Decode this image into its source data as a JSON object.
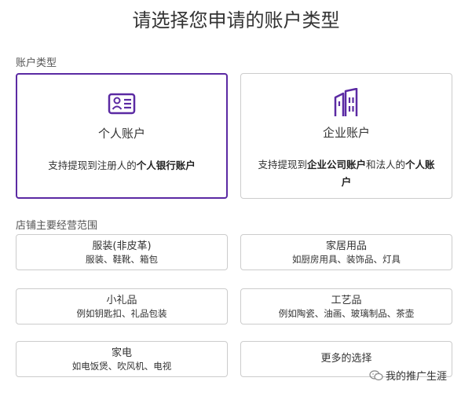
{
  "page": {
    "title": "请选择您申请的账户类型"
  },
  "account_section": {
    "label": "账户类型",
    "personal": {
      "name": "个人账户",
      "desc_prefix": "支持提现到注册人的",
      "desc_bold": "个人银行账户",
      "icon": "id-card-icon",
      "selected": true
    },
    "business": {
      "name": "企业账户",
      "desc_prefix": "支持提现到",
      "desc_bold": "企业公司账户",
      "desc_mid": "和法人的",
      "desc_bold2": "个人账户",
      "icon": "building-icon"
    }
  },
  "category_section": {
    "label": "店铺主要经营范围",
    "items": [
      {
        "title": "服装(非皮革)",
        "subtitle": "服装、鞋靴、箱包"
      },
      {
        "title": "家居用品",
        "subtitle": "如厨房用具、装饰品、灯具"
      },
      {
        "title": "小礼品",
        "subtitle": "例如钥匙扣、礼品包装"
      },
      {
        "title": "工艺品",
        "subtitle": "例如陶瓷、油画、玻璃制品、茶壶"
      },
      {
        "title": "家电",
        "subtitle": "如电饭煲、吹风机、电视"
      },
      {
        "title": "更多的选择"
      }
    ]
  },
  "watermark": {
    "text": "我的推广生涯",
    "icon": "wechat-icon"
  },
  "colors": {
    "accent": "#5b2aa3",
    "border": "#cccccc",
    "text": "#333333"
  }
}
